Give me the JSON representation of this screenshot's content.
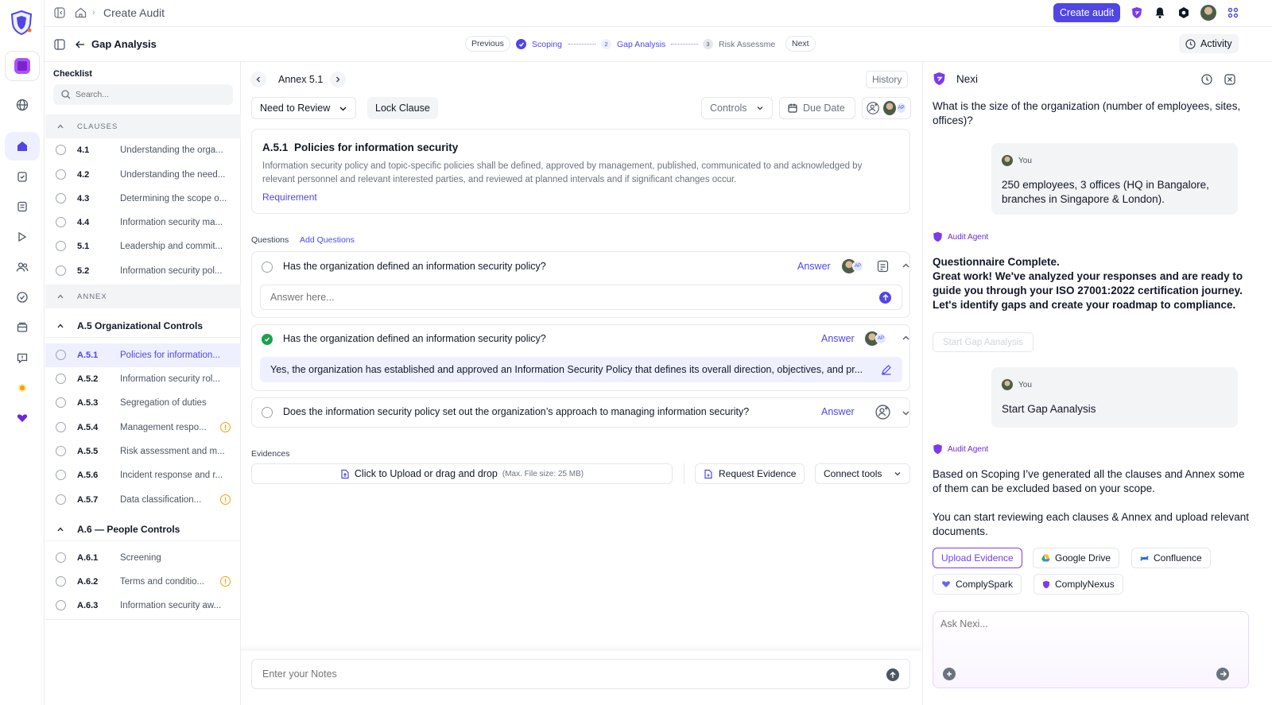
{
  "topbar": {
    "breadcrumb_current": "Create Audit",
    "create_audit_label": "Create audit"
  },
  "subbar": {
    "title": "Gap Analysis",
    "previous_label": "Previous",
    "steps": [
      {
        "index": "",
        "label": "Scoping"
      },
      {
        "index": "2",
        "label": "Gap Analysis"
      },
      {
        "index": "3",
        "label": "Risk Assessme"
      }
    ],
    "next_label": "Next",
    "activity_label": "Activity"
  },
  "checklist": {
    "title": "Checklist",
    "search_placeholder": "Search...",
    "clauses_header": "CLAUSES",
    "clauses": [
      {
        "num": "4.1",
        "title": "Understanding the orga..."
      },
      {
        "num": "4.2",
        "title": "Understanding the need..."
      },
      {
        "num": "4.3",
        "title": "Determining the scope o..."
      },
      {
        "num": "4.4",
        "title": "Information security ma..."
      },
      {
        "num": "5.1",
        "title": "Leadership and commit..."
      },
      {
        "num": "5.2",
        "title": "Information security pol..."
      }
    ],
    "annex_header": "ANNEX",
    "group_a5": "A.5 Organizational Controls",
    "a5_items": [
      {
        "num": "A.5.1",
        "title": "Policies for information..."
      },
      {
        "num": "A.5.2",
        "title": "Information security rol..."
      },
      {
        "num": "A.5.3",
        "title": "Segregation of duties"
      },
      {
        "num": "A.5.4",
        "title": "Management respo..."
      },
      {
        "num": "A.5.5",
        "title": "Risk assessment and m..."
      },
      {
        "num": "A.5.6",
        "title": "Incident response and r..."
      },
      {
        "num": "A.5.7",
        "title": "Data classification..."
      }
    ],
    "group_a6": "A.6 — People Controls",
    "a6_items": [
      {
        "num": "A.6.1",
        "title": "Screening"
      },
      {
        "num": "A.6.2",
        "title": "Terms and conditio..."
      },
      {
        "num": "A.6.3",
        "title": "Information security aw..."
      }
    ],
    "warn_symbol": "!"
  },
  "main": {
    "annex_title": "Annex 5.1",
    "history_label": "History",
    "status_select": "Need to Review",
    "lock_clause_label": "Lock Clause",
    "controls_label": "Controls",
    "due_date_label": "Due Date",
    "clause": {
      "id": "A.5.1",
      "title": "Policies for information security",
      "description": "Information security policy and topic-specific policies shall be defined, approved by management, published, communicated to and acknowledged by relevant personnel and relevant interested parties, and reviewed at planned intervals and if significant changes occur.",
      "requirement_label": "Requirement"
    },
    "questions_label": "Questions",
    "add_questions_label": "Add Questions",
    "questions": [
      {
        "text": "Has the organization defined an information security policy?",
        "answer_label": "Answer",
        "input_placeholder": "Answer here...",
        "badge": "AP"
      },
      {
        "text": "Has the organization defined an information security policy?",
        "answer_label": "Answer",
        "answer_text": "Yes, the organization has established and approved an Information Security Policy that defines its overall direction, objectives, and pr...",
        "badge": "AP"
      },
      {
        "text": "Does the information security policy set out the organization’s approach to managing information security?",
        "answer_label": "Answer"
      }
    ],
    "evidences_label": "Evidences",
    "upload_label": "Click to Upload or drag and drop",
    "upload_hint": "(Max. File size: 25 MB)",
    "request_evidence_label": "Request Evidence",
    "connect_tools_label": "Connect tools",
    "notes_placeholder": "Enter your Notes"
  },
  "chat": {
    "title": "Nexi",
    "first_question": "What is the size of the organization (number of employees, sites, offices)?",
    "you_label": "You",
    "user_msg_1": "250 employees, 3 offices (HQ in Bangalore, branches in Singapore & London).",
    "agent_label": "Audit Agent",
    "agent_msg_1_title": "Questionnaire Complete.",
    "agent_msg_1_body": "Great work! We've analyzed your responses and are ready to guide you through your ISO 27001:2022 certification journey. Let's identify gaps and create your roadmap to compliance.",
    "start_gap_label": "Start Gap Aanalysis",
    "user_msg_2": "Start Gap Aanalysis",
    "agent_msg_2_p1": "Based on Scoping I’ve generated all the clauses and Annex some of them can be excluded based on your scope.",
    "agent_msg_2_p2": "You can start reviewing each clauses & Annex and upload relevant documents.",
    "chips": [
      "Upload Evidence",
      "Google Drive",
      "Confluence",
      "ComplySpark",
      "ComplyNexus"
    ],
    "input_placeholder": "Ask Nexi..."
  }
}
